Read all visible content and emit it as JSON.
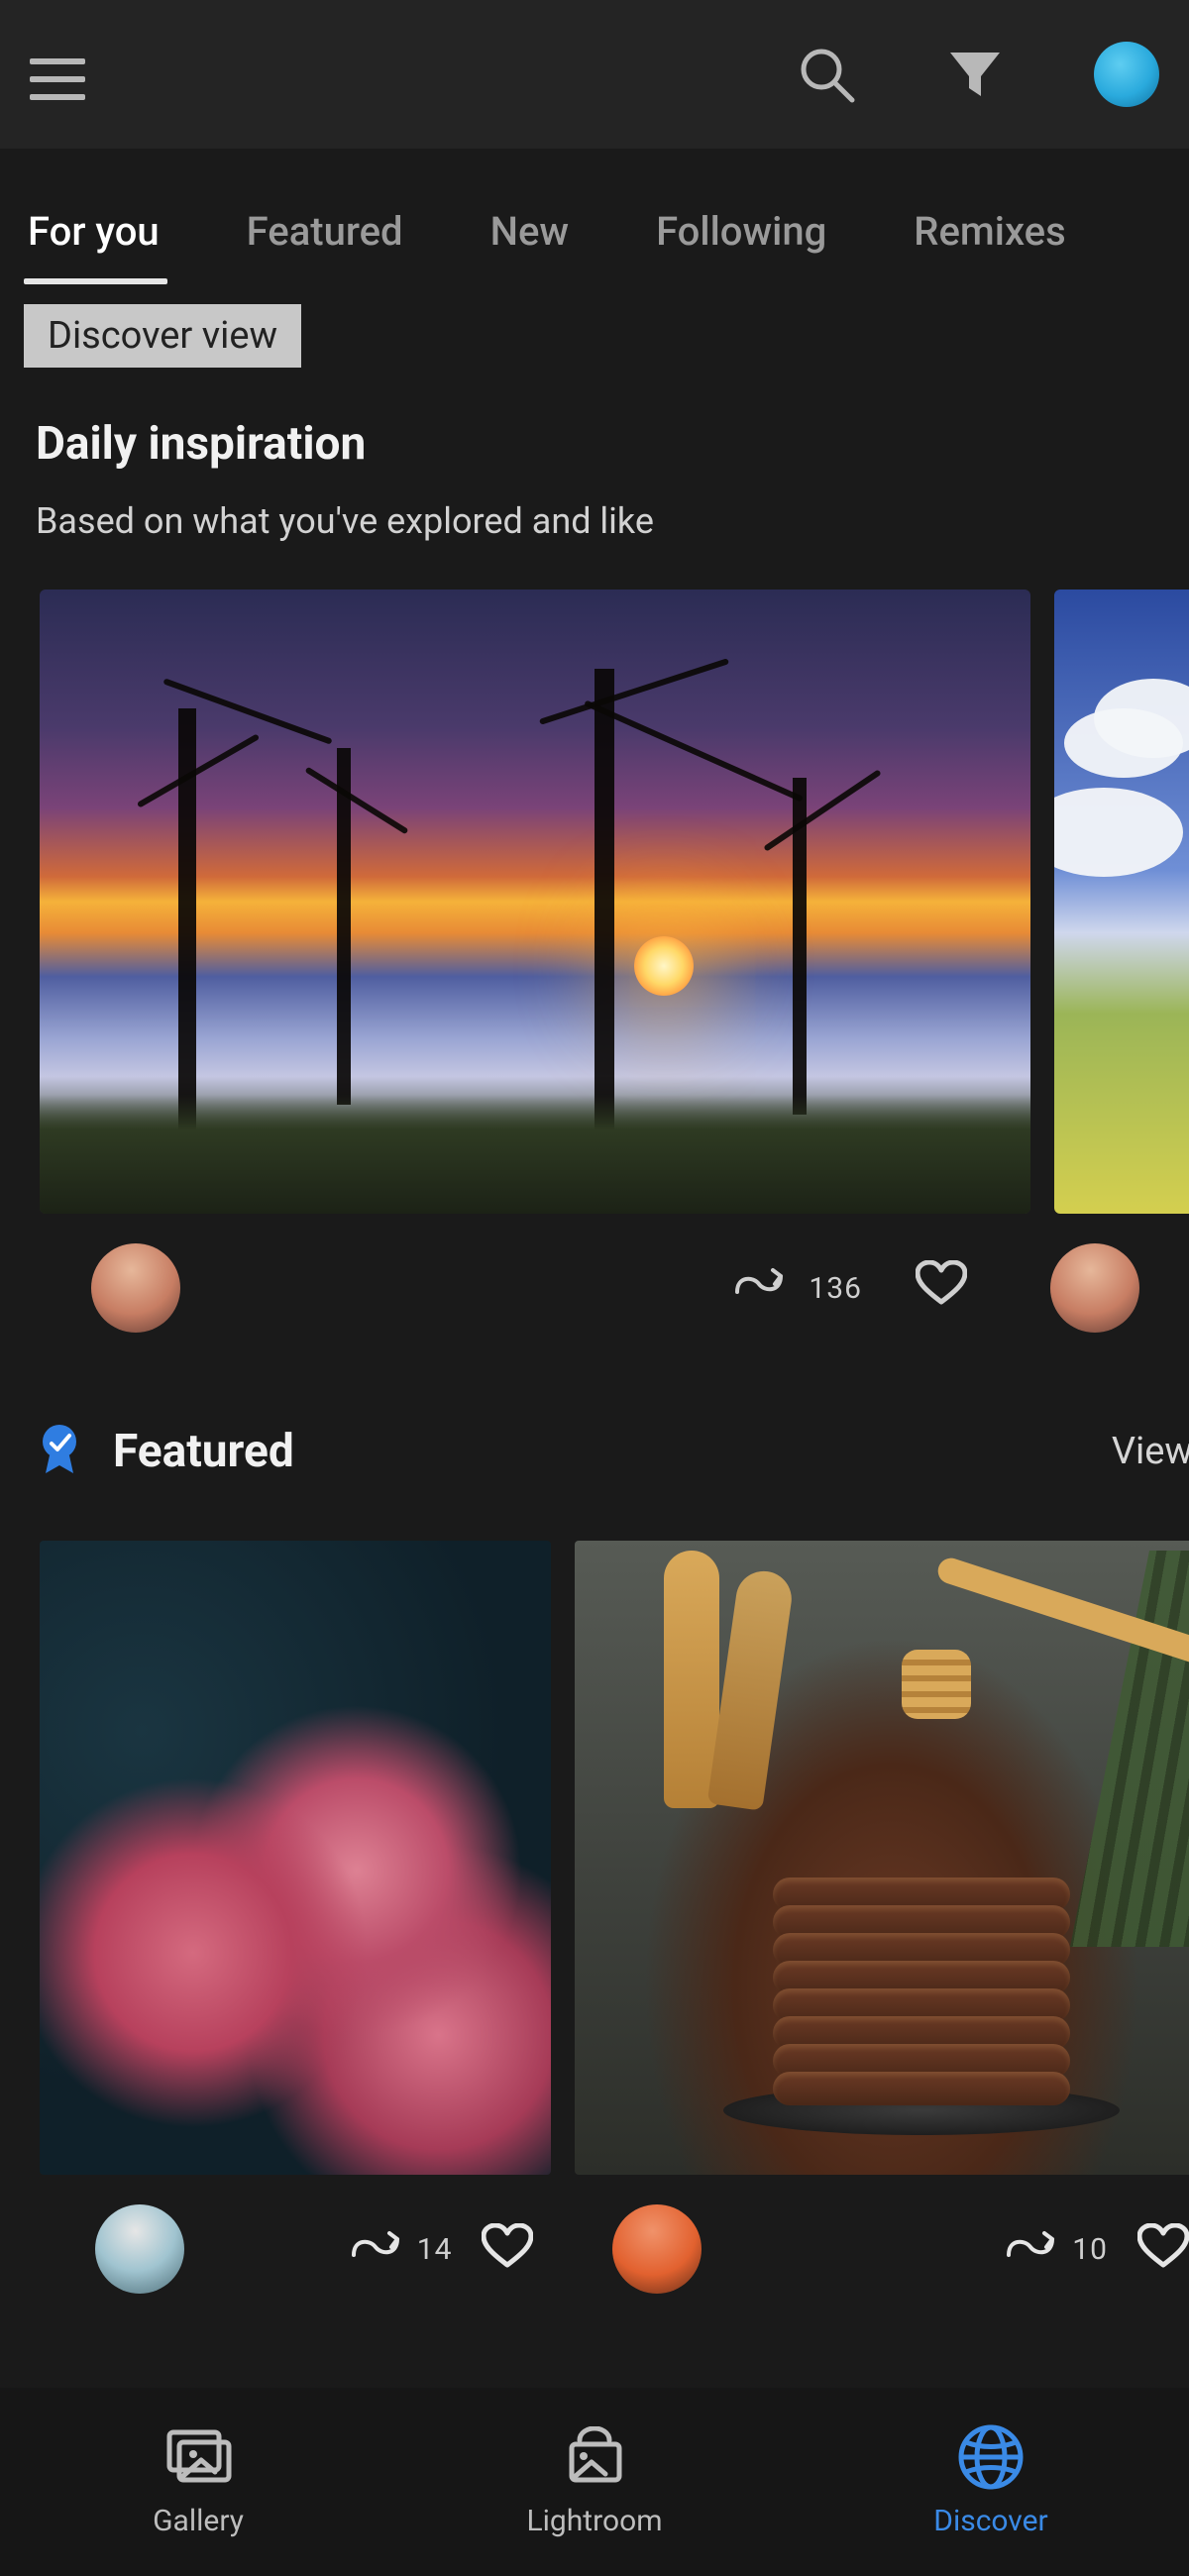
{
  "tabs": {
    "items": [
      {
        "label": "For you",
        "active": true
      },
      {
        "label": "Featured",
        "active": false
      },
      {
        "label": "New",
        "active": false
      },
      {
        "label": "Following",
        "active": false
      },
      {
        "label": "Remixes",
        "active": false
      }
    ]
  },
  "chip": {
    "label": "Discover view"
  },
  "daily": {
    "title": "Daily inspiration",
    "subtitle": "Based on what you've explored and like",
    "cards": [
      {
        "remix_count": "136"
      }
    ]
  },
  "featured": {
    "title": "Featured",
    "view_label": "View",
    "cards": [
      {
        "remix_count": "14"
      },
      {
        "remix_count": "10"
      }
    ]
  },
  "bottomnav": {
    "items": [
      {
        "label": "Gallery",
        "active": false
      },
      {
        "label": "Lightroom",
        "active": false
      },
      {
        "label": "Discover",
        "active": true
      }
    ]
  },
  "colors": {
    "accent": "#3a8ae6",
    "avatar_accent": "#2aaadd"
  }
}
